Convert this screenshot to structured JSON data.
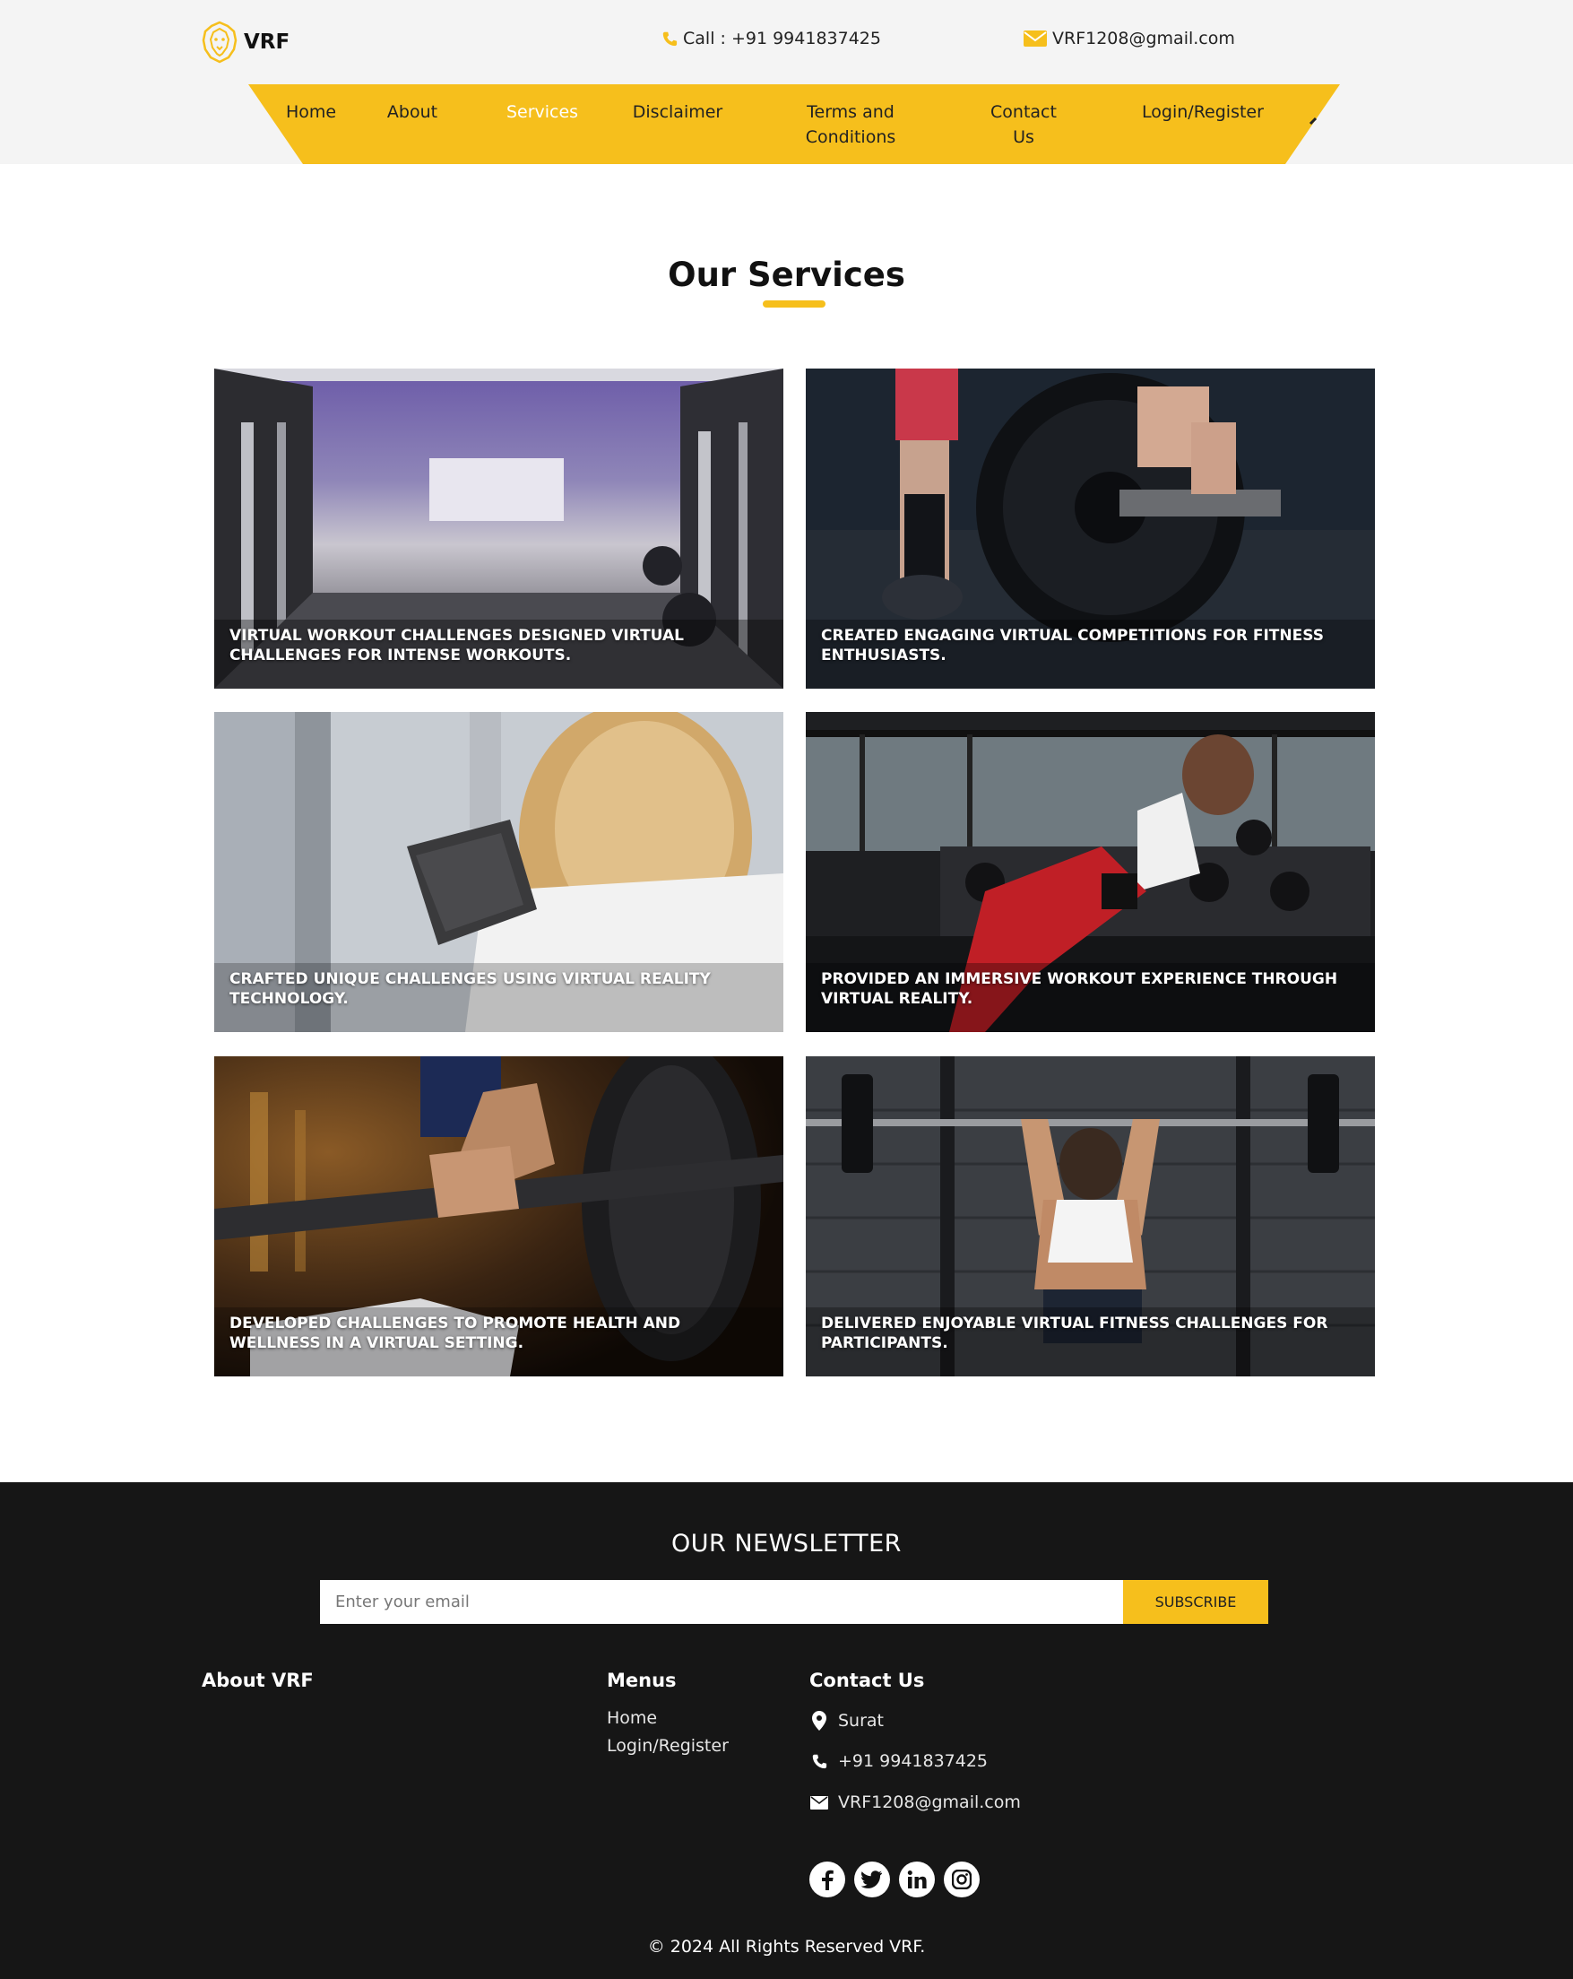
{
  "brand": {
    "name": "VRF",
    "accent": "#f6bf1c",
    "icon": "lion-logo-icon"
  },
  "topbar": {
    "phone": "Call : +91 9941837425",
    "email": "VRF1208@gmail.com",
    "phone_icon": "phone-icon",
    "email_icon": "mail-icon"
  },
  "nav": {
    "items": [
      {
        "label": "Home",
        "active": false
      },
      {
        "label": "About",
        "active": false
      },
      {
        "label": "Services",
        "active": true
      },
      {
        "label": "Disclaimer",
        "active": false
      },
      {
        "label": "Terms and Conditions",
        "active": false
      },
      {
        "label": "Contact Us",
        "active": false
      },
      {
        "label": "Login/Register",
        "active": false
      }
    ]
  },
  "services": {
    "title": "Our Services",
    "cards": [
      {
        "caption": "Virtual workout challenges designed virtual challenges for intense workouts."
      },
      {
        "caption": "Created engaging virtual competitions for fitness enthusiasts."
      },
      {
        "caption": "Crafted unique challenges using virtual reality technology."
      },
      {
        "caption": "Provided an immersive workout experience through virtual reality."
      },
      {
        "caption": "Developed challenges to promote health and wellness in a virtual setting."
      },
      {
        "caption": "Delivered enjoyable virtual fitness challenges for participants."
      }
    ]
  },
  "footer": {
    "newsletter": {
      "title": "OUR NEWSLETTER",
      "placeholder": "Enter your email",
      "button": "SUBSCRIBE"
    },
    "about_title": "About VRF",
    "menus_title": "Menus",
    "menus": [
      "Home",
      "Login/Register"
    ],
    "contact_title": "Contact Us",
    "contact": {
      "location": "Surat",
      "phone": "+91 9941837425",
      "email": "VRF1208@gmail.com"
    },
    "socials": [
      "facebook-icon",
      "twitter-icon",
      "linkedin-icon",
      "instagram-icon"
    ],
    "copyright": "© 2024 All Rights Reserved VRF."
  }
}
